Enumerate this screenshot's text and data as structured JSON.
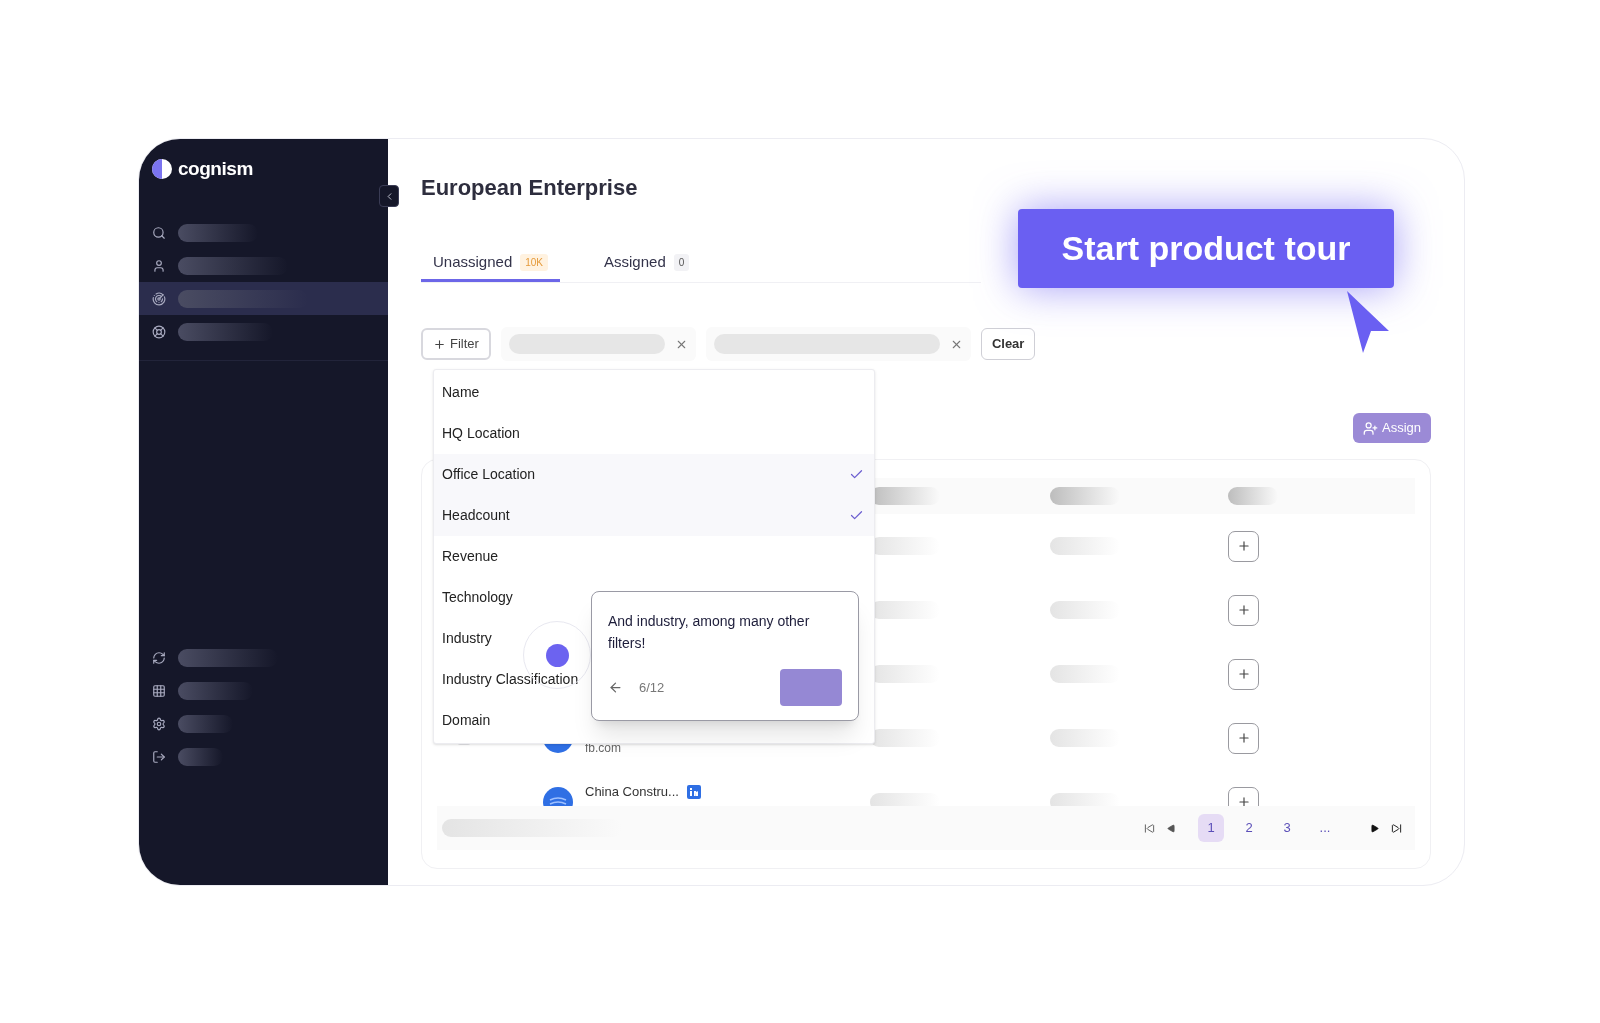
{
  "brand": {
    "name": "cognism"
  },
  "sidebar": {
    "top_items": [
      {
        "kind": "search",
        "selected": false
      },
      {
        "kind": "user",
        "selected": false
      },
      {
        "kind": "radar",
        "selected": true
      },
      {
        "kind": "support",
        "selected": false
      }
    ],
    "bottom_items": [
      {
        "kind": "refresh",
        "selected": false
      },
      {
        "kind": "grid",
        "selected": false
      },
      {
        "kind": "settings",
        "selected": false
      },
      {
        "kind": "logout",
        "selected": false
      }
    ]
  },
  "page": {
    "title": "European Enterprise"
  },
  "tabs": [
    {
      "label": "Unassigned",
      "count": "10K",
      "selected": true
    },
    {
      "label": "Assigned",
      "count": "0",
      "selected": false
    }
  ],
  "filter_bar": {
    "filter_button": "Filter",
    "chips": [
      {
        "kind": "placeholder"
      },
      {
        "kind": "placeholder"
      }
    ],
    "clear_button": "Clear"
  },
  "filter_menu": [
    {
      "label": "Name",
      "checked": false
    },
    {
      "label": "HQ Location",
      "checked": false
    },
    {
      "label": "Office Location",
      "checked": true
    },
    {
      "label": "Headcount",
      "checked": true
    },
    {
      "label": "Revenue",
      "checked": false
    },
    {
      "label": "Technology",
      "checked": false
    },
    {
      "label": "Industry",
      "checked": false
    },
    {
      "label": "Industry Classification",
      "checked": false
    },
    {
      "label": "Domain",
      "checked": false
    }
  ],
  "tour_tooltip": {
    "text": "And industry, among many other filters!",
    "step": "6/12"
  },
  "tour_button": "Start product tour",
  "assign_button": "Assign",
  "table": {
    "rows": [
      {
        "kind": "placeholder"
      },
      {
        "kind": "placeholder"
      },
      {
        "kind": "placeholder"
      },
      {
        "kind": "company",
        "checked": false,
        "domain": "fb.com"
      },
      {
        "kind": "company",
        "name": "China Constru...",
        "linkedin": true
      }
    ]
  },
  "pagination": {
    "pages": [
      {
        "label": "1",
        "selected": true
      },
      {
        "label": "2",
        "selected": false
      },
      {
        "label": "3",
        "selected": false
      },
      {
        "label": "...",
        "selected": false
      }
    ]
  }
}
